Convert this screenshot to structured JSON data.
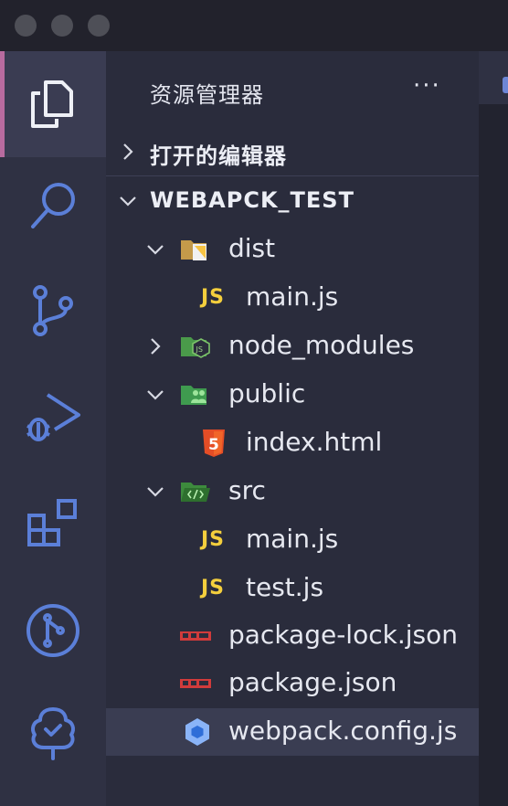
{
  "colors": {
    "activity_bg": "#2f3143",
    "sidebar_bg": "#2a2c3c",
    "active_indicator": "#b86b9f",
    "js_yellow": "#f4cf3d",
    "html_red": "#e44d26",
    "npm_red": "#d13b3b",
    "folder_green": "#4caf50",
    "webpack_blue": "#8ab4f8"
  },
  "activity_bar": [
    {
      "icon": "files-icon",
      "active": true
    },
    {
      "icon": "search-icon"
    },
    {
      "icon": "source-control-icon"
    },
    {
      "icon": "run-debug-icon"
    },
    {
      "icon": "extensions-icon"
    },
    {
      "icon": "git-graph-icon"
    },
    {
      "icon": "tree-check-icon"
    }
  ],
  "sidebar": {
    "title": "资源管理器",
    "more": "···",
    "open_editors": {
      "label": "打开的编辑器",
      "expanded": false
    },
    "project": {
      "label": "WEBAPCK_TEST",
      "expanded": true
    }
  },
  "tree": [
    {
      "name": "dist",
      "type": "folder",
      "expanded": true,
      "icon": "dist-folder-icon"
    },
    {
      "name": "main.js",
      "type": "file",
      "icon": "js-file-icon",
      "icon_text": "JS"
    },
    {
      "name": "node_modules",
      "type": "folder",
      "expanded": false,
      "icon": "node-folder-icon"
    },
    {
      "name": "public",
      "type": "folder",
      "expanded": true,
      "icon": "public-folder-icon"
    },
    {
      "name": "index.html",
      "type": "file",
      "icon": "html5-file-icon"
    },
    {
      "name": "src",
      "type": "folder",
      "expanded": true,
      "icon": "src-folder-icon"
    },
    {
      "name": "main.js",
      "type": "file",
      "icon": "js-file-icon",
      "icon_text": "JS"
    },
    {
      "name": "test.js",
      "type": "file",
      "icon": "js-file-icon",
      "icon_text": "JS"
    },
    {
      "name": "package-lock.json",
      "type": "file",
      "icon": "npm-file-icon"
    },
    {
      "name": "package.json",
      "type": "file",
      "icon": "npm-file-icon"
    },
    {
      "name": "webpack.config.js",
      "type": "file",
      "icon": "webpack-file-icon",
      "selected": true
    }
  ]
}
